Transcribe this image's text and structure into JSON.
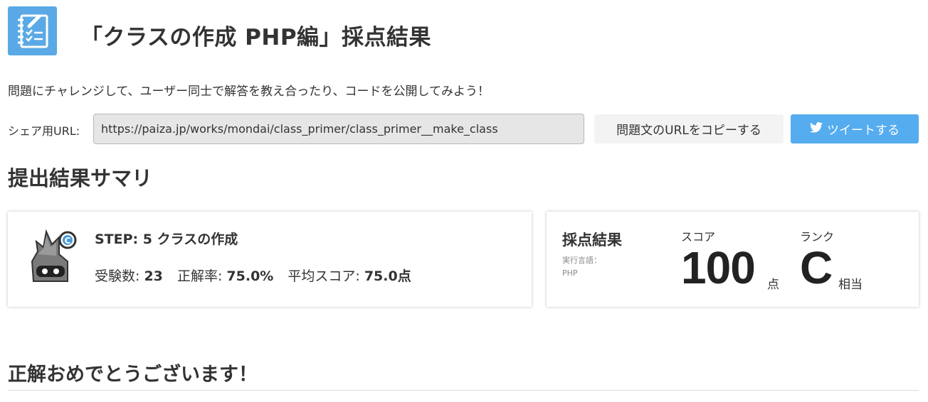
{
  "header": {
    "icon": "notebook-checklist-icon",
    "title": "「クラスの作成 PHP編」採点結果"
  },
  "intro": "問題にチャレンジして、ユーザー同士で解答を教え合ったり、コードを公開してみよう！",
  "share": {
    "label": "シェア用URL:",
    "url": "https://paiza.jp/works/mondai/class_primer/class_primer__make_class",
    "copy_button": "問題文のURLをコピーする",
    "tweet_button": "ツイートする",
    "tweet_icon": "twitter-bird-icon"
  },
  "summary": {
    "heading": "提出結果サマリ",
    "step": {
      "mascot_icon": "c-rank-mascot-icon",
      "title": "STEP: 5 クラスの作成",
      "examinees_label": "受験数:",
      "examinees_value": "23",
      "accuracy_label": "正解率:",
      "accuracy_value": "75.0%",
      "avg_label": "平均スコア:",
      "avg_value": "75.0点"
    },
    "result": {
      "title": "採点結果",
      "lang_label": "実行言語：",
      "lang_value": "PHP",
      "score_label": "スコア",
      "score_value": "100",
      "score_unit": "点",
      "rank_label": "ランク",
      "rank_value": "C",
      "rank_unit": "相当"
    }
  },
  "congrats": "正解おめでとうございます！",
  "colors": {
    "accent_blue": "#5aa9e6",
    "twitter_blue": "#55acee"
  }
}
